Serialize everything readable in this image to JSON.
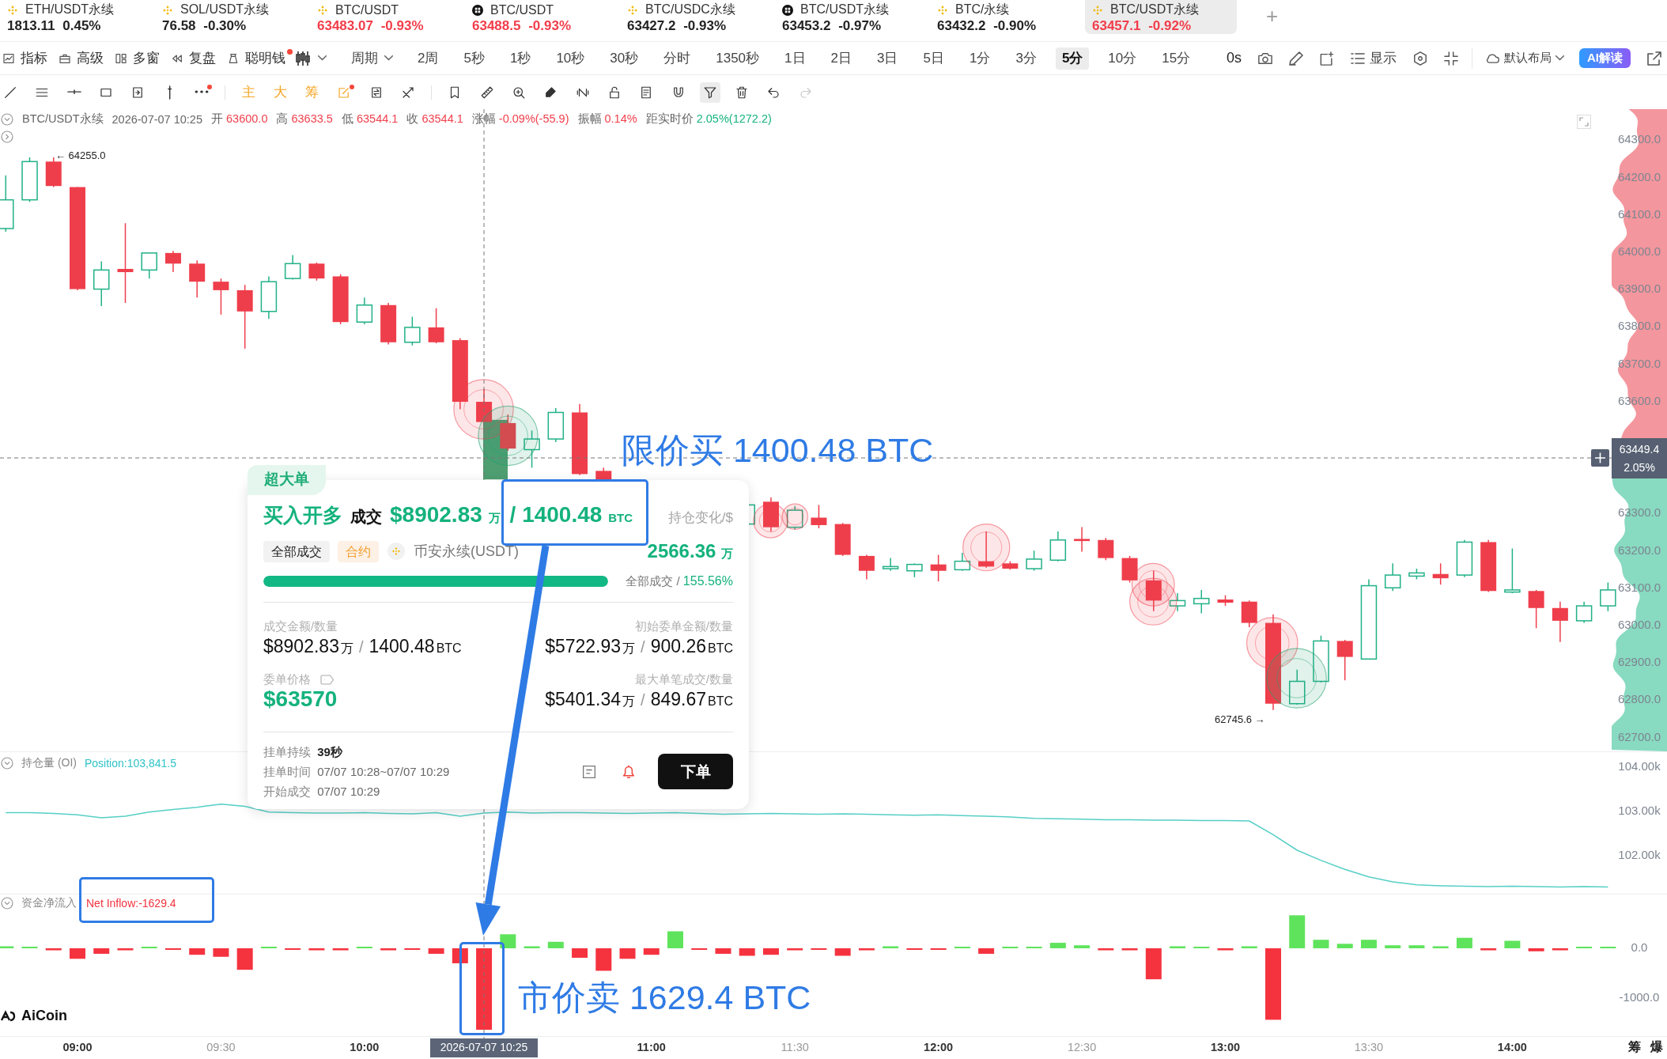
{
  "tabs": [
    {
      "name": "ETH/USDT永续",
      "price": "1813.11",
      "change": "0.45%",
      "kind": "diamond",
      "color": "#222222",
      "selected": false
    },
    {
      "name": "SOL/USDT永续",
      "price": "76.58",
      "change": "-0.30%",
      "kind": "diamond",
      "color": "#222222",
      "selected": false
    },
    {
      "name": "BTC/USDT",
      "price": "63483.07",
      "change": "-0.93%",
      "kind": "diamond",
      "color": "#f23d4a",
      "selected": false
    },
    {
      "name": "BTC/USDT",
      "price": "63488.5",
      "change": "-0.93%",
      "kind": "checker",
      "color": "#f23d4a",
      "selected": false
    },
    {
      "name": "BTC/USDC永续",
      "price": "63427.2",
      "change": "-0.93%",
      "kind": "diamond",
      "color": "#222222",
      "selected": false
    },
    {
      "name": "BTC/USDT永续",
      "price": "63453.2",
      "change": "-0.97%",
      "kind": "checker",
      "color": "#222222",
      "selected": false
    },
    {
      "name": "BTC/永续",
      "price": "63432.2",
      "change": "-0.90%",
      "kind": "diamond",
      "color": "#222222",
      "selected": false
    },
    {
      "name": "BTC/USDT永续",
      "price": "63457.1",
      "change": "-0.92%",
      "kind": "diamond",
      "color": "#f23d4a",
      "selected": true
    }
  ],
  "add_tab": "+",
  "toolbar": {
    "menus": [
      {
        "label": "指标",
        "dot": false
      },
      {
        "label": "高级",
        "dot": false
      },
      {
        "label": "多窗",
        "dot": false
      },
      {
        "label": "复盘",
        "dot": false
      },
      {
        "label": "聪明钱",
        "dot": true
      }
    ],
    "period_menu": "周期",
    "periods": [
      {
        "label": "2周",
        "selected": false
      },
      {
        "label": "5秒",
        "selected": false
      },
      {
        "label": "1秒",
        "selected": false
      },
      {
        "label": "10秒",
        "selected": false
      },
      {
        "label": "30秒",
        "selected": false
      },
      {
        "label": "分时",
        "selected": false
      },
      {
        "label": "1350秒",
        "selected": false
      },
      {
        "label": "1日",
        "selected": false
      },
      {
        "label": "2日",
        "selected": false
      },
      {
        "label": "3日",
        "selected": false
      },
      {
        "label": "5日",
        "selected": false
      },
      {
        "label": "1分",
        "selected": false
      },
      {
        "label": "3分",
        "selected": false
      },
      {
        "label": "5分",
        "selected": true
      },
      {
        "label": "10分",
        "selected": false
      },
      {
        "label": "15分",
        "selected": false
      }
    ],
    "countdown": "0s",
    "display_button": "显示",
    "layout_menu": "默认布局",
    "ai_button": "AI解读"
  },
  "tools": [
    [
      {
        "kind": "icon",
        "selected": false,
        "dot": false,
        "disabled": false
      },
      {
        "kind": "icon",
        "selected": false,
        "dot": false,
        "disabled": false
      },
      {
        "kind": "icon",
        "selected": false,
        "dot": false,
        "disabled": false
      },
      {
        "kind": "icon",
        "selected": false,
        "dot": false,
        "disabled": false
      },
      {
        "kind": "icon",
        "selected": false,
        "dot": false,
        "disabled": false
      },
      {
        "kind": "icon",
        "selected": false,
        "dot": false,
        "disabled": false
      },
      {
        "kind": "icon",
        "selected": false,
        "dot": true,
        "disabled": false
      }
    ],
    [
      {
        "kind": "char",
        "label": "主",
        "selected": false,
        "dot": false,
        "disabled": false
      },
      {
        "kind": "char",
        "label": "大",
        "selected": false,
        "dot": false,
        "disabled": false
      },
      {
        "kind": "char",
        "label": "筹",
        "selected": false,
        "dot": false,
        "disabled": false
      },
      {
        "kind": "icon",
        "selected": false,
        "dot": true,
        "disabled": false
      },
      {
        "kind": "icon",
        "selected": false,
        "dot": false,
        "disabled": false
      },
      {
        "kind": "icon",
        "selected": false,
        "dot": false,
        "disabled": false
      }
    ],
    [
      {
        "kind": "icon",
        "selected": false,
        "dot": false,
        "disabled": false
      },
      {
        "kind": "icon",
        "selected": false,
        "dot": false,
        "disabled": false
      },
      {
        "kind": "icon",
        "selected": false,
        "dot": false,
        "disabled": false
      },
      {
        "kind": "icon",
        "selected": false,
        "dot": false,
        "disabled": false
      },
      {
        "kind": "icon",
        "selected": false,
        "dot": false,
        "disabled": false
      },
      {
        "kind": "icon",
        "selected": false,
        "dot": false,
        "disabled": false
      },
      {
        "kind": "icon",
        "selected": false,
        "dot": false,
        "disabled": false
      },
      {
        "kind": "icon",
        "selected": false,
        "dot": false,
        "disabled": false
      },
      {
        "kind": "icon",
        "selected": true,
        "dot": false,
        "disabled": false
      },
      {
        "kind": "icon",
        "selected": false,
        "dot": false,
        "disabled": false
      },
      {
        "kind": "icon",
        "selected": false,
        "dot": false,
        "disabled": false
      },
      {
        "kind": "icon",
        "selected": false,
        "dot": false,
        "disabled": true
      }
    ]
  ],
  "quote": {
    "symbol": "BTC/USDT永续",
    "time": "2026-07-07 10:25",
    "fields": [
      {
        "label": "开",
        "value": "63600.0",
        "color": "#f0414d"
      },
      {
        "label": "高",
        "value": "63633.5",
        "color": "#f0414d"
      },
      {
        "label": "低",
        "value": "63544.1",
        "color": "#f0414d"
      },
      {
        "label": "收",
        "value": "63544.1",
        "color": "#f0414d"
      },
      {
        "label": "涨幅",
        "value": "-0.09%(-55.9)",
        "color": "#f0414d"
      },
      {
        "label": "振幅",
        "value": "0.14%",
        "color": "#f0414d"
      },
      {
        "label": "距实时价",
        "value": "2.05%(1272.2)",
        "color": "#17b47f"
      }
    ]
  },
  "price_chart": {
    "high_label": "← 64255.0",
    "low_label": "62745.6 →",
    "axis_labels_upper": [
      "64300.0",
      "64200.0",
      "64100.0",
      "64000.0",
      "63900.0",
      "63800.0",
      "63700.0",
      "63600.0"
    ],
    "axis_labels_lower": [
      "63300.0",
      "63200.0",
      "63100.0",
      "63000.0",
      "62900.0",
      "62800.0",
      "62700.0"
    ]
  },
  "crosshair": {
    "time": "2026-07-07 10:25",
    "price": "63449.4",
    "change": "2.05%"
  },
  "order_card": {
    "tag": "超大单",
    "side": "买入开多",
    "fill_label": "成交",
    "fill_amount": "$8902.83",
    "fill_amount_unit": "万",
    "fill_qty": "/ 1400.48",
    "fill_qty_unit": "BTC",
    "position_change_label": "持仓变化/$",
    "chips": [
      {
        "kind": "status",
        "label": "全部成交"
      },
      {
        "kind": "contract",
        "label": "合约"
      }
    ],
    "venue": "币安永续(USDT)",
    "position_change": "2566.36",
    "position_change_unit": "万",
    "progress": {
      "level": 1,
      "status": "全部成交",
      "separator": "/",
      "percent": "155.56%"
    },
    "stats": [
      {
        "kind": "amount",
        "label": "成交金额/数量",
        "parts": [
          {
            "kind": "num",
            "text": "$8902.83"
          },
          {
            "kind": "unit",
            "text": "万"
          },
          {
            "kind": "sep",
            "text": "/"
          },
          {
            "kind": "num",
            "text": "1400.48"
          },
          {
            "kind": "unit",
            "text": "BTC"
          }
        ]
      },
      {
        "kind": "amount",
        "label": "初始委单金额/数量",
        "parts": [
          {
            "kind": "num",
            "text": "$5722.93"
          },
          {
            "kind": "unit",
            "text": "万"
          },
          {
            "kind": "sep",
            "text": "/"
          },
          {
            "kind": "num",
            "text": "900.26"
          },
          {
            "kind": "unit",
            "text": "BTC"
          }
        ]
      },
      {
        "kind": "price",
        "label": "委单价格",
        "parts": [
          {
            "kind": "num",
            "text": "$63570"
          }
        ]
      },
      {
        "kind": "amount",
        "label": "最大单笔成交/数量",
        "parts": [
          {
            "kind": "num",
            "text": "$5401.34"
          },
          {
            "kind": "unit",
            "text": "万"
          },
          {
            "kind": "sep",
            "text": "/"
          },
          {
            "kind": "num",
            "text": "849.67"
          },
          {
            "kind": "unit",
            "text": "BTC"
          }
        ]
      }
    ],
    "timing": [
      {
        "kind": "duration",
        "label": "挂单持续",
        "value": "39秒"
      },
      {
        "kind": "time",
        "label": "挂单时间",
        "value": "07/07 10:28~07/07 10:29"
      },
      {
        "kind": "time",
        "label": "开始成交",
        "value": "07/07 10:29"
      }
    ],
    "order_button": "下单"
  },
  "annotations": {
    "limit_note": "限价买 1400.48 BTC",
    "market_note": "市价卖 1629.4 BTC"
  },
  "oi_pane": {
    "label": "持仓量 (OI)",
    "value": "Position:103,841.5",
    "chart_data": {
      "type": "line",
      "categories": [
        null,
        null,
        null,
        null,
        null,
        null,
        null,
        null,
        null,
        null,
        null,
        null,
        null,
        null,
        null,
        null,
        null,
        null,
        null,
        null,
        null,
        null,
        null,
        null,
        null,
        null,
        null,
        null,
        null,
        null,
        null,
        null,
        null,
        null,
        null,
        null,
        null,
        null,
        null,
        null,
        null,
        null,
        null,
        null,
        null,
        null,
        null,
        null,
        null,
        null,
        null,
        null,
        null,
        null,
        null,
        null,
        null,
        null,
        null,
        null,
        null,
        null,
        null,
        null,
        null,
        null,
        null,
        null
      ],
      "values": [
        102980,
        102980,
        102960,
        102930,
        102860,
        102900,
        102990,
        103050,
        103100,
        103170,
        103120,
        102990,
        102980,
        102970,
        102970,
        102980,
        102960,
        102950,
        102980,
        102900,
        102970,
        102990,
        102970,
        102980,
        102980,
        102970,
        102960,
        102970,
        102980,
        102960,
        102940,
        102950,
        102960,
        102950,
        102940,
        102950,
        102940,
        102930,
        102920,
        102930,
        102910,
        102900,
        102880,
        102850,
        102840,
        102830,
        102820,
        102820,
        102810,
        102810,
        102800,
        102800,
        102790,
        102480,
        102130,
        101900,
        101700,
        101530,
        101420,
        101350,
        101330,
        101320,
        101310,
        101320,
        101310,
        101300,
        101310,
        101300
      ],
      "ylim": [
        101150,
        104360
      ],
      "yticks": [
        {
          "value": 104000,
          "label": "104.00k"
        },
        {
          "value": 103000,
          "label": "103.00k"
        },
        {
          "value": 102000,
          "label": "102.00k"
        }
      ]
    }
  },
  "flow_pane": {
    "label": "资金净流入",
    "value": "Net Inflow:-1629.4",
    "chart_data": {
      "type": "bar",
      "categories": [
        null,
        null,
        null,
        "09:00",
        null,
        null,
        null,
        null,
        null,
        "09:30",
        null,
        null,
        null,
        null,
        null,
        "10:00",
        null,
        null,
        null,
        null,
        null,
        null,
        null,
        null,
        null,
        null,
        null,
        "11:00",
        null,
        null,
        null,
        null,
        null,
        "11:30",
        null,
        null,
        null,
        null,
        null,
        "12:00",
        null,
        null,
        null,
        null,
        null,
        "12:30",
        null,
        null,
        null,
        null,
        null,
        "13:00",
        null,
        null,
        null,
        null,
        null,
        "13:30",
        null,
        null,
        null,
        null,
        null,
        "14:00",
        null,
        null,
        null,
        null
      ],
      "values": [
        40,
        20,
        -40,
        -210,
        -110,
        -40,
        20,
        -20,
        -130,
        -170,
        -430,
        20,
        -20,
        -40,
        -40,
        20,
        -40,
        -20,
        -110,
        -300,
        -1630,
        280,
        40,
        130,
        -190,
        -450,
        -210,
        -130,
        340,
        -20,
        -110,
        -150,
        -130,
        -40,
        -20,
        -150,
        -40,
        40,
        -20,
        -20,
        20,
        -110,
        20,
        20,
        110,
        60,
        -40,
        -40,
        -620,
        40,
        20,
        -40,
        40,
        -1430,
        660,
        170,
        90,
        170,
        60,
        60,
        40,
        210,
        -40,
        150,
        -60,
        -40,
        20,
        20
      ],
      "ylim": [
        -1756,
        1092
      ],
      "yticks": [
        {
          "value": 0,
          "label": "0.0"
        },
        {
          "value": -1000,
          "label": "-1000.0"
        }
      ]
    }
  },
  "logo": "AiCoin",
  "corner_labels": [
    "筹",
    "爆"
  ]
}
